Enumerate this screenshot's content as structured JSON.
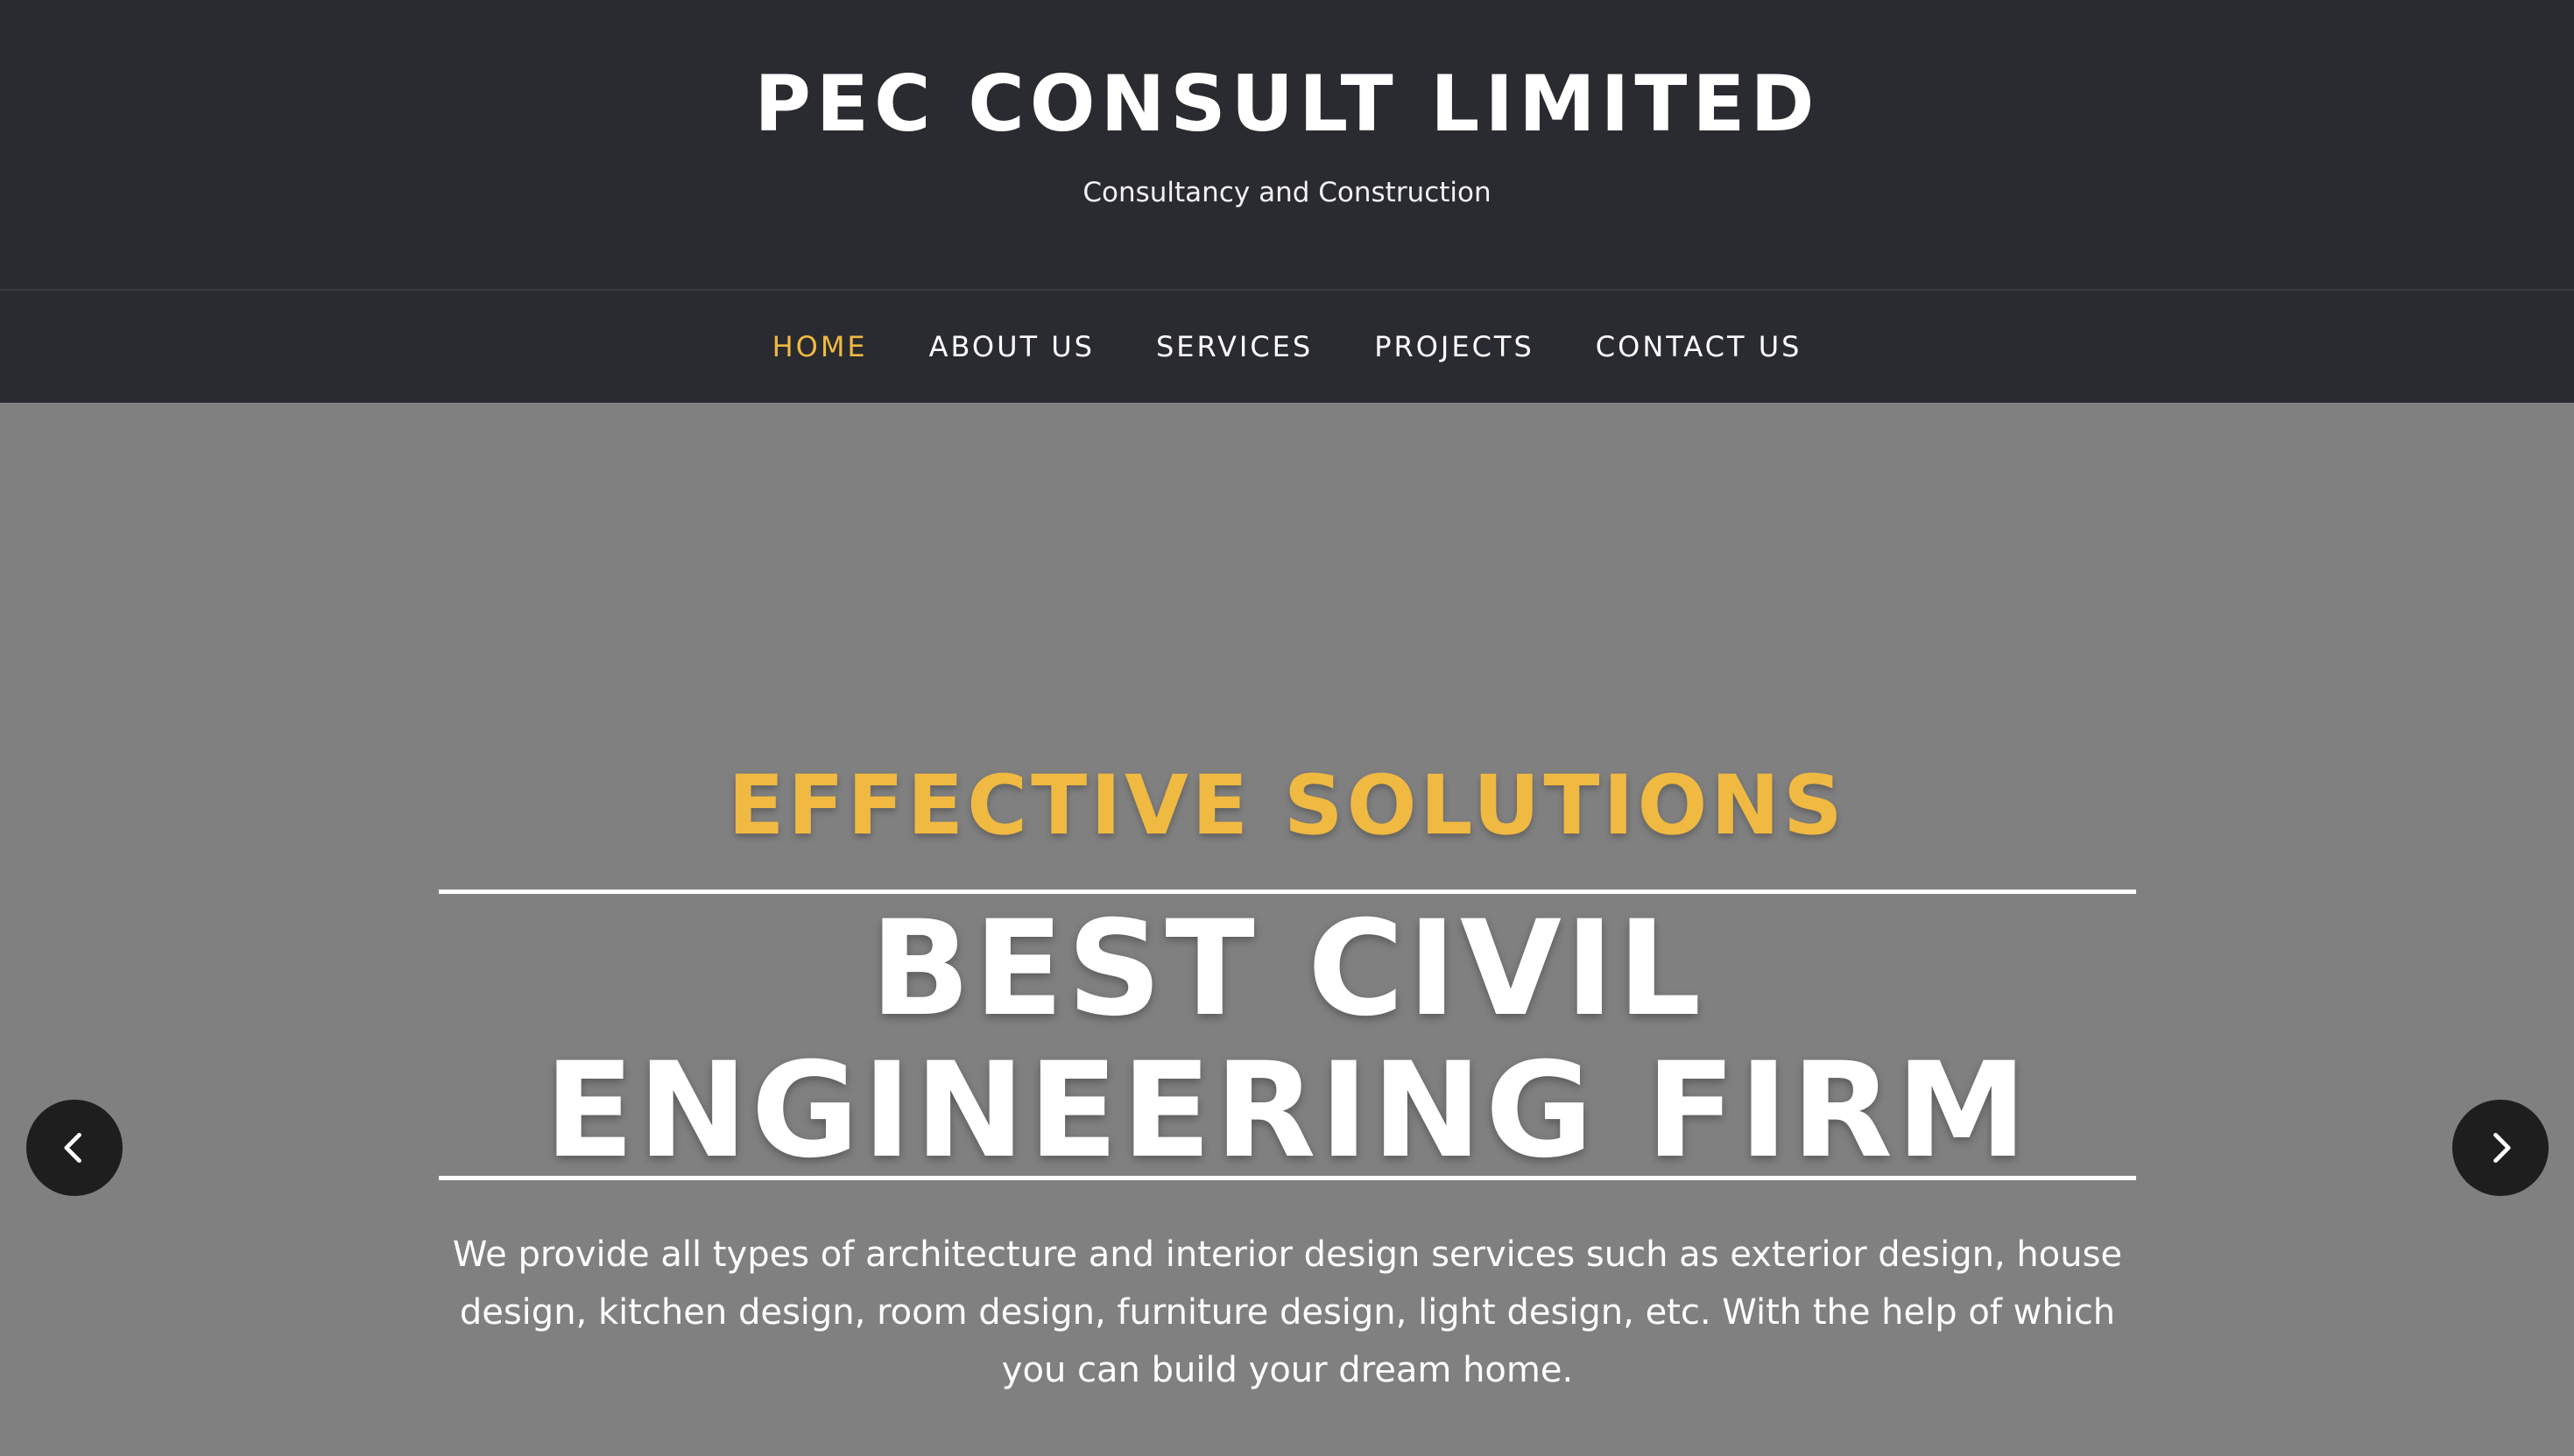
{
  "site": {
    "title": "PEC CONSULT LIMITED",
    "tagline": "Consultancy and Construction"
  },
  "nav": {
    "items": [
      {
        "label": "HOME",
        "active": true
      },
      {
        "label": "ABOUT US",
        "active": false
      },
      {
        "label": "SERVICES",
        "active": false
      },
      {
        "label": "PROJECTS",
        "active": false
      },
      {
        "label": "CONTACT US",
        "active": false
      }
    ]
  },
  "hero": {
    "kicker": "EFFECTIVE SOLUTIONS",
    "title": "BEST CIVIL ENGINEERING FIRM",
    "description": "We provide all types of architecture and interior design services such as exterior design, house design, kitchen design, room design, furniture design, light design, etc. With the help of which you can build your dream home.",
    "prev_icon": "chevron-left-icon",
    "next_icon": "chevron-right-icon"
  },
  "colors": {
    "header_bg": "#2a2b30",
    "accent": "#f0b942",
    "hero_bg": "#808080",
    "arrow_bg": "#1e1e1e"
  }
}
